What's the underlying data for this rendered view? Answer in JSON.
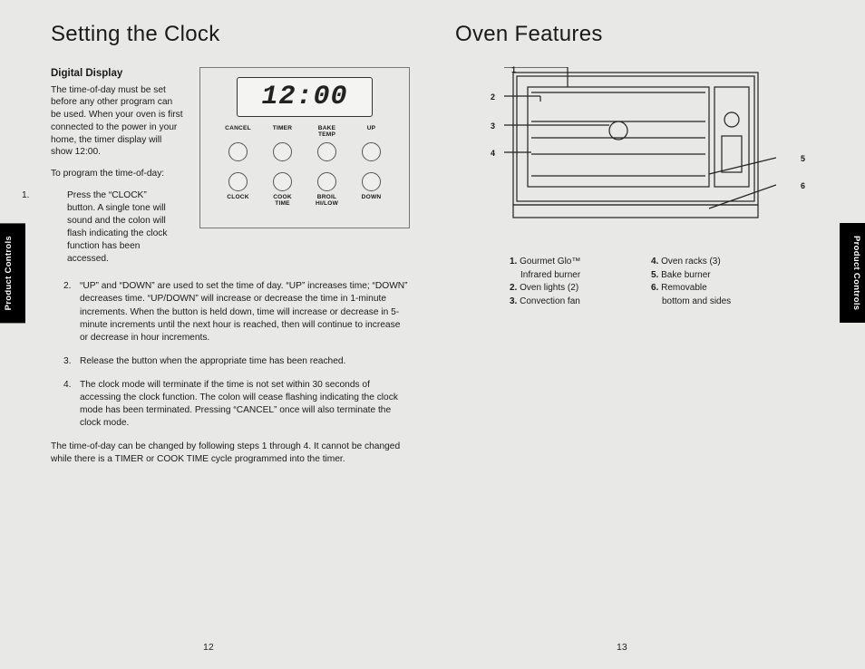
{
  "left": {
    "title": "Setting the Clock",
    "subhead": "Digital Display",
    "intro1": "The time-of-day must be set before any other program can be used. When your oven is first connected to the power in your home, the timer display will show 12:00.",
    "intro2": "To program the time-of-day:",
    "lcd": "12:00",
    "row1": [
      "CANCEL",
      "TIMER",
      "BAKE\nTEMP",
      "UP"
    ],
    "row2": [
      "CLOCK",
      "COOK\nTIME",
      "BROIL\nHI/LOW",
      "DOWN"
    ],
    "steps": [
      "Press the “CLOCK” button. A single tone will sound and the colon will flash indicating the clock function has been accessed.",
      "“UP” and “DOWN” are used to set the time of day. “UP” increases time; “DOWN” decreases time. “UP/DOWN” will increase or decrease the time in 1-minute increments. When the button is held down, time will increase or decrease in 5-minute increments until the next hour is reached, then will continue to increase or decrease in hour increments.",
      "Release the button when the appropriate time has been reached.",
      "The clock mode will terminate if the time is not set within 30 seconds of accessing the clock function. The colon will cease flashing indicating the clock mode has been terminated. Pressing “CANCEL” once will also terminate the clock mode."
    ],
    "footnote": "The time-of-day can be changed by following steps 1 through 4. It cannot be changed while there is a TIMER or COOK TIME cycle programmed into the timer."
  },
  "right": {
    "title": "Oven Features",
    "callouts": [
      "1",
      "2",
      "3",
      "4",
      "5",
      "6"
    ],
    "legend_left": [
      {
        "num": "1.",
        "text": "Gourmet Glo™",
        "sub": "Infrared burner"
      },
      {
        "num": "2.",
        "text": "Oven lights (2)"
      },
      {
        "num": "3.",
        "text": "Convection fan"
      }
    ],
    "legend_right": [
      {
        "num": "4.",
        "text": "Oven racks (3)"
      },
      {
        "num": "5.",
        "text": "Bake burner"
      },
      {
        "num": "6.",
        "text": "Removable",
        "sub": "bottom and sides"
      }
    ]
  },
  "tabs": {
    "left": "Product Controls",
    "right": "Product Controls"
  },
  "pages": {
    "left": "12",
    "right": "13"
  }
}
